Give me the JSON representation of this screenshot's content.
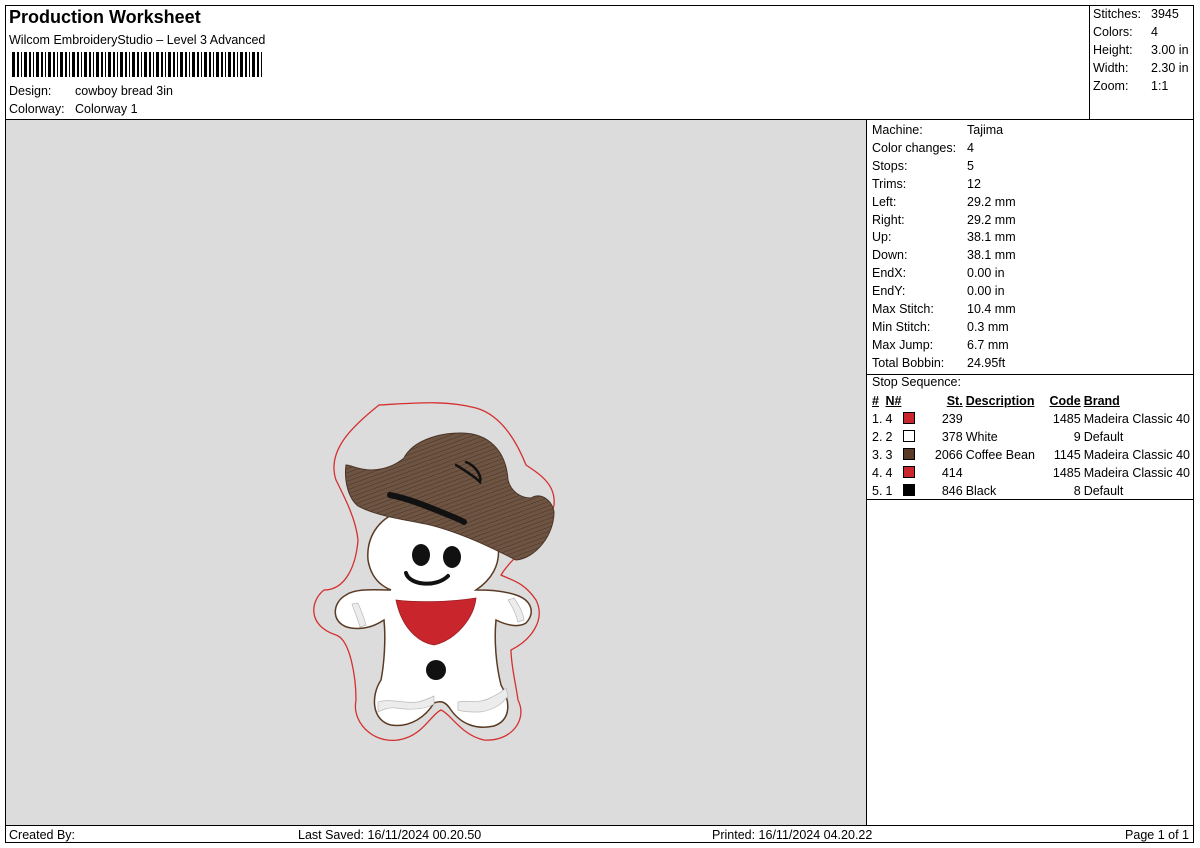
{
  "header": {
    "title": "Production Worksheet",
    "software": "Wilcom EmbroideryStudio – Level 3 Advanced",
    "design_label": "Design:",
    "design_value": "cowboy bread 3in",
    "colorway_label": "Colorway:",
    "colorway_value": "Colorway 1"
  },
  "summary": {
    "stitches_label": "Stitches:",
    "stitches": "3945",
    "colors_label": "Colors:",
    "colors": "4",
    "height_label": "Height:",
    "height": "3.00 in",
    "width_label": "Width:",
    "width": "2.30 in",
    "zoom_label": "Zoom:",
    "zoom": "1:1"
  },
  "machine_info": [
    {
      "label": "Machine:",
      "value": "Tajima"
    },
    {
      "label": "Color changes:",
      "value": "4"
    },
    {
      "label": "Stops:",
      "value": "5"
    },
    {
      "label": "Trims:",
      "value": "12"
    },
    {
      "label": "Left:",
      "value": "29.2 mm"
    },
    {
      "label": "Right:",
      "value": "29.2 mm"
    },
    {
      "label": "Up:",
      "value": "38.1 mm"
    },
    {
      "label": "Down:",
      "value": "38.1 mm"
    },
    {
      "label": "EndX:",
      "value": "0.00 in"
    },
    {
      "label": "EndY:",
      "value": "0.00 in"
    },
    {
      "label": "Max Stitch:",
      "value": "10.4 mm"
    },
    {
      "label": "Min Stitch:",
      "value": "0.3 mm"
    },
    {
      "label": "Max Jump:",
      "value": "6.7 mm"
    },
    {
      "label": "Total Bobbin:",
      "value": "24.95ft"
    }
  ],
  "stop_sequence": {
    "title": "Stop Sequence:",
    "headers": {
      "index": "#",
      "needle": "N#",
      "stitches": "St.",
      "description": "Description",
      "code": "Code",
      "brand": "Brand"
    },
    "rows": [
      {
        "index": "1.",
        "needle": "4",
        "color": "#c8262c",
        "stitches": "239",
        "description": "",
        "code": "1485",
        "brand": "Madeira Classic 40"
      },
      {
        "index": "2.",
        "needle": "2",
        "color": "#ffffff",
        "stitches": "378",
        "description": "White",
        "code": "9",
        "brand": "Default"
      },
      {
        "index": "3.",
        "needle": "3",
        "color": "#5a3a24",
        "stitches": "2066",
        "description": "Coffee Bean",
        "code": "1145",
        "brand": "Madeira Classic 40"
      },
      {
        "index": "4.",
        "needle": "4",
        "color": "#c8262c",
        "stitches": "414",
        "description": "",
        "code": "1485",
        "brand": "Madeira Classic 40"
      },
      {
        "index": "5.",
        "needle": "1",
        "color": "#000000",
        "stitches": "846",
        "description": "Black",
        "code": "8",
        "brand": "Default"
      }
    ]
  },
  "footer": {
    "created_by": "Created By:",
    "last_saved": "Last Saved: 16/11/2024 00.20.50",
    "printed": "Printed: 16/11/2024 04.20.22",
    "page": "Page 1 of 1"
  },
  "colors": {
    "canvas_bg": "#dcdcdc",
    "hat_brown": "#6b5040",
    "bandana_red": "#c8262c",
    "outline_red": "#d43030"
  }
}
